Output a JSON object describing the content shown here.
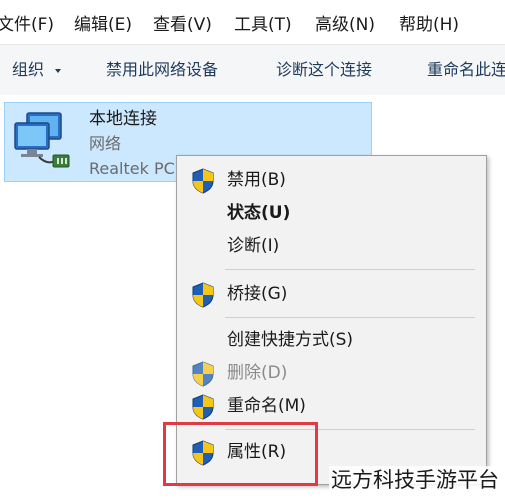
{
  "menubar": {
    "items": [
      "文件(F)",
      "编辑(E)",
      "查看(V)",
      "工具(T)",
      "高级(N)",
      "帮助(H)"
    ]
  },
  "toolbar": {
    "organize": "组织",
    "disable_device": "禁用此网络设备",
    "diagnose": "诊断这个连接",
    "rename": "重命名此连"
  },
  "connection": {
    "name": "本地连接",
    "type": "网络",
    "device": "Realtek PC",
    "icon": "network-adapter-icon"
  },
  "context_menu": {
    "items": [
      {
        "label": "禁用(B)",
        "icon": "uac-shield-icon"
      },
      {
        "label": "状态(U)",
        "bold": true
      },
      {
        "label": "诊断(I)"
      },
      {
        "label": "桥接(G)",
        "icon": "uac-shield-icon"
      },
      {
        "label": "创建快捷方式(S)"
      },
      {
        "label": "删除(D)",
        "icon": "uac-shield-icon",
        "disabled": true
      },
      {
        "label": "重命名(M)",
        "icon": "uac-shield-icon"
      },
      {
        "label": "属性(R)",
        "icon": "uac-shield-icon",
        "highlighted": true
      }
    ]
  },
  "watermark": "远方科技手游平台",
  "colors": {
    "selection_bg": "#cce8ff",
    "selection_border": "#99d1ff",
    "menu_bg": "#f2f2f2",
    "highlight_box": "#e03a44",
    "shield_blue": "#1f5fb4",
    "shield_yellow": "#f5c518"
  }
}
